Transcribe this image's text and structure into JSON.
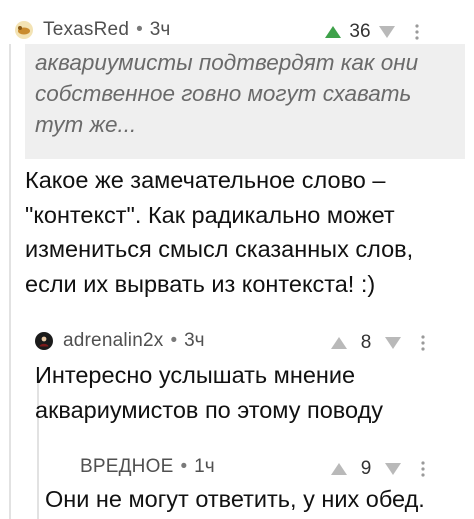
{
  "comments": [
    {
      "username": "TexasRed",
      "time": "3ч",
      "score": "36",
      "quote": "аквариумисты подтвердят как они собственное говно могут схавать тут же...",
      "text": "Какое же замечательное слово – \"контекст\". Как радикально может измениться смысл сказанных слов, если их вырвать из контекста! :)",
      "upvote_color": "#3ea14a"
    },
    {
      "username": "adrenalin2x",
      "time": "3ч",
      "score": "8",
      "text": "Интересно услышать мнение аквариумистов по этому поводу"
    },
    {
      "username": "ВРЕДНОЕ",
      "time": "1ч",
      "score": "9",
      "text": "Они не могут ответить, у них обед."
    }
  ],
  "icons": {
    "upvote": "triangle-up-icon",
    "downvote": "triangle-down-icon",
    "more": "vertical-dots-icon"
  }
}
